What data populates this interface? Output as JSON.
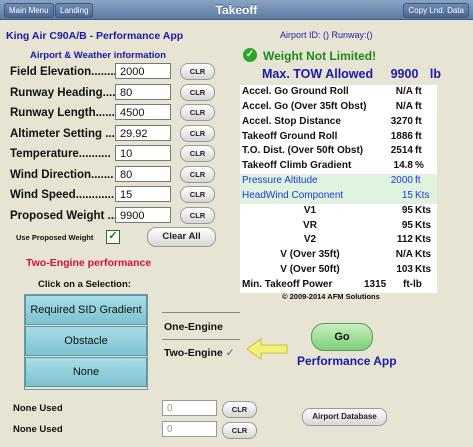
{
  "nav": {
    "title": "Takeoff",
    "main_menu": "Main Menu",
    "landing": "Landing",
    "copy": "Copy Lnd. Data"
  },
  "app_title": "King Air C90A/B - Performance App",
  "airport_id": "Airport ID: () Runway:()",
  "inputs_title": "Airport & Weather information",
  "fields": [
    {
      "label": "Field Elevation........",
      "value": "2000"
    },
    {
      "label": "Runway Heading.....",
      "value": "80"
    },
    {
      "label": "Runway Length......",
      "value": "4500"
    },
    {
      "label": "Altimeter Setting ...",
      "value": "29.92"
    },
    {
      "label": "Temperature..........",
      "value": "10"
    },
    {
      "label": "Wind Direction.......",
      "value": "80"
    },
    {
      "label": "Wind Speed............",
      "value": "15"
    },
    {
      "label": "Proposed Weight ...",
      "value": "9900"
    }
  ],
  "clr_label": "CLR",
  "use_proposed_weight": "Use Proposed Weight",
  "use_proposed_checked": "✓",
  "clear_all": "Clear All",
  "two_engine_title": "Two-Engine performance",
  "click_selection": "Click on a Selection:",
  "selection_buttons": [
    "Required SID Gradient",
    "Obstacle",
    "None"
  ],
  "engine_options": {
    "one": "One-Engine",
    "two": "Two-Engine",
    "check": "✓"
  },
  "go_label": "Go",
  "performance_app": "Performance App",
  "weight_status": "Weight Not Limited!",
  "max_tow": {
    "label": "Max. TOW Allowed",
    "value": "9900",
    "unit": "lb"
  },
  "results": [
    {
      "label": "Accel. Go Ground Roll",
      "value": "N/A",
      "unit": "ft"
    },
    {
      "label": "Accel. Go (Over 35ft Obst)",
      "value": "N/A",
      "unit": "ft"
    },
    {
      "label": "Accel. Stop Distance",
      "value": "3270",
      "unit": "ft"
    },
    {
      "label": "Takeoff Ground Roll",
      "value": "1886",
      "unit": "ft"
    },
    {
      "label": "T.O. Dist. (Over 50ft Obst)",
      "value": "2514",
      "unit": "ft"
    },
    {
      "label": "Takeoff Climb Gradient",
      "value": "14.8",
      "unit": "%"
    },
    {
      "label": "Pressure Altitude",
      "value": "2000",
      "unit": "ft"
    },
    {
      "label": "HeadWind Component",
      "value": "15",
      "unit": "Kts"
    },
    {
      "label": "V1",
      "value": "95",
      "unit": "Kts"
    },
    {
      "label": "VR",
      "value": "95",
      "unit": "Kts"
    },
    {
      "label": "V2",
      "value": "112",
      "unit": "Kts"
    },
    {
      "label": "V (Over 35ft)",
      "value": "N/A",
      "unit": "Kts"
    },
    {
      "label": "V (Over 50ft)",
      "value": "103",
      "unit": "Kts"
    },
    {
      "label": "Min. Takeoff Power",
      "value": "1315",
      "unit": "ft-lb"
    }
  ],
  "copyright": "© 2009-2014 AFM Solutions",
  "none_used": [
    {
      "label": "None Used",
      "placeholder": "0"
    },
    {
      "label": "None Used",
      "placeholder": "0"
    }
  ],
  "airport_database": "Airport Database"
}
